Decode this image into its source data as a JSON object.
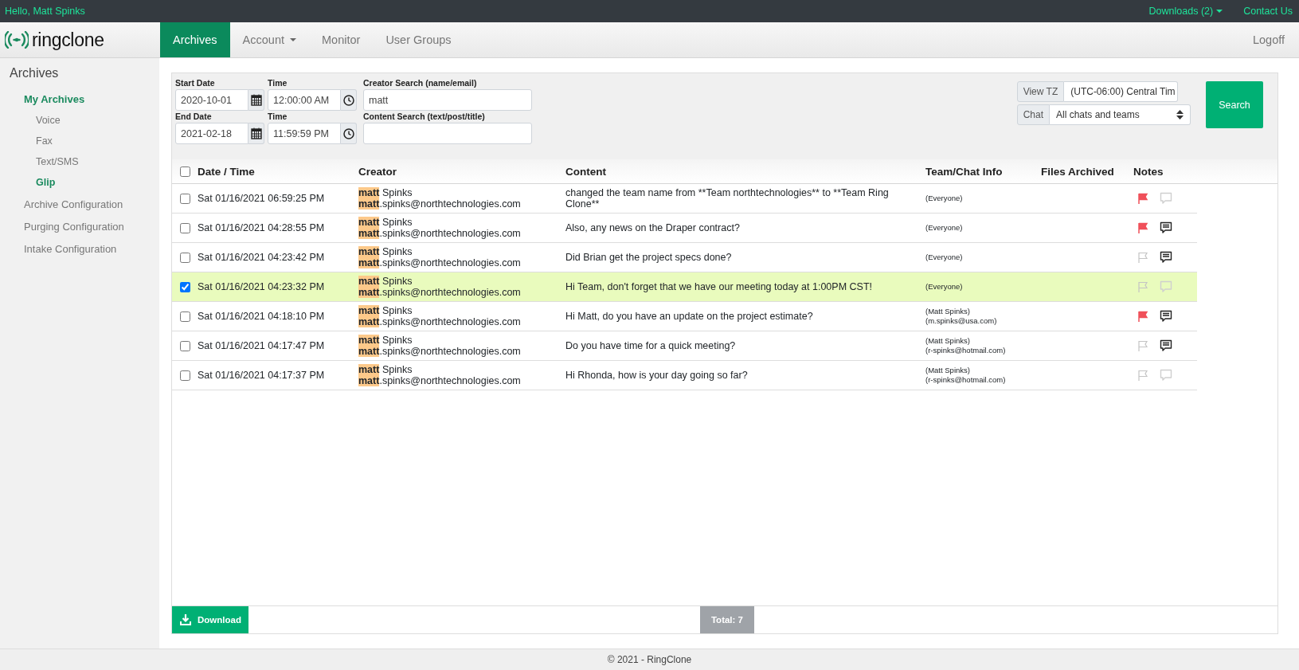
{
  "top_bar": {
    "greeting": "Hello, Matt Spinks",
    "links": [
      {
        "label": "Downloads (2)",
        "dropdown": true
      },
      {
        "label": "Contact Us",
        "dropdown": false
      }
    ]
  },
  "nav": {
    "logo": "ringclone",
    "tabs": [
      {
        "label": "Archives",
        "selected": true,
        "dropdown": false
      },
      {
        "label": "Account",
        "selected": false,
        "dropdown": true
      },
      {
        "label": "Monitor",
        "selected": false,
        "dropdown": false
      },
      {
        "label": "User Groups",
        "selected": false,
        "dropdown": false
      }
    ],
    "logoff": "Logoff"
  },
  "sidebar": {
    "title": "Archives",
    "items": [
      {
        "label": "My Archives",
        "selected": true,
        "children": [
          {
            "label": "Voice",
            "selected": false
          },
          {
            "label": "Fax",
            "selected": false
          },
          {
            "label": "Text/SMS",
            "selected": false
          },
          {
            "label": "Glip",
            "selected": true
          }
        ]
      },
      {
        "label": "Archive Configuration",
        "selected": false
      },
      {
        "label": "Purging Configuration",
        "selected": false
      },
      {
        "label": "Intake Configuration",
        "selected": false
      }
    ]
  },
  "filters": {
    "start_date": {
      "label": "Start Date",
      "value": "2020-10-01"
    },
    "start_time": {
      "label": "Time",
      "value": "12:00:00 AM"
    },
    "creator_search": {
      "label": "Creator Search (name/email)",
      "value": "matt"
    },
    "end_date": {
      "label": "End Date",
      "value": "2021-02-18"
    },
    "end_time": {
      "label": "Time",
      "value": "11:59:59 PM"
    },
    "content_search": {
      "label": "Content Search (text/post/title)"
    },
    "view_tz": {
      "label": "View TZ",
      "value": "(UTC-06:00) Central Tim"
    },
    "chat": {
      "label": "Chat",
      "value": "All chats and teams"
    },
    "search_button": "Search"
  },
  "table": {
    "select_all": false,
    "columns": [
      "Date / Time",
      "Creator",
      "Content",
      "Team/Chat Info",
      "Files Archived",
      "Notes"
    ],
    "rows": [
      {
        "selected": false,
        "date": "Sat 01/16/2021 06:59:25 PM",
        "name_match": "matt",
        "email_match": "matt",
        "name_rest": " Spinks",
        "email_rest": ".spinks@northtechnologies.com",
        "content": "changed the team name from **Team northtechnologies** to **Team Ring Clone**",
        "team": [
          "(Everyone)"
        ],
        "flagged": true,
        "has_note": false
      },
      {
        "selected": false,
        "date": "Sat 01/16/2021 04:28:55 PM",
        "name_match": "matt",
        "email_match": "matt",
        "name_rest": " Spinks",
        "email_rest": ".spinks@northtechnologies.com",
        "content": "Also, any news on the Draper contract?",
        "team": [
          "(Everyone)"
        ],
        "flagged": true,
        "has_note": true
      },
      {
        "selected": false,
        "date": "Sat 01/16/2021 04:23:42 PM",
        "name_match": "matt",
        "email_match": "matt",
        "name_rest": " Spinks",
        "email_rest": ".spinks@northtechnologies.com",
        "content": "Did Brian get the project specs done?",
        "team": [
          "(Everyone)"
        ],
        "flagged": false,
        "has_note": true
      },
      {
        "selected": true,
        "date": "Sat 01/16/2021 04:23:32 PM",
        "name_match": "matt",
        "email_match": "matt",
        "name_rest": " Spinks",
        "email_rest": ".spinks@northtechnologies.com",
        "content": "Hi Team, don't forget that we have our meeting today at 1:00PM CST!",
        "team": [
          "(Everyone)"
        ],
        "flagged": false,
        "has_note": false
      },
      {
        "selected": false,
        "date": "Sat 01/16/2021 04:18:10 PM",
        "name_match": "matt",
        "email_match": "matt",
        "name_rest": " Spinks",
        "email_rest": ".spinks@northtechnologies.com",
        "content": "Hi Matt, do you have an update on the project estimate?",
        "team": [
          "(Matt Spinks)",
          "(m.spinks@usa.com)"
        ],
        "flagged": true,
        "has_note": true
      },
      {
        "selected": false,
        "date": "Sat 01/16/2021 04:17:47 PM",
        "name_match": "matt",
        "email_match": "matt",
        "name_rest": " Spinks",
        "email_rest": ".spinks@northtechnologies.com",
        "content": "Do you have time for a quick meeting?",
        "team": [
          "(Matt Spinks)",
          "(r-spinks@hotmail.com)"
        ],
        "flagged": false,
        "has_note": true
      },
      {
        "selected": false,
        "date": "Sat 01/16/2021 04:17:37 PM",
        "name_match": "matt",
        "email_match": "matt",
        "name_rest": " Spinks",
        "email_rest": ".spinks@northtechnologies.com",
        "content": "Hi Rhonda, how is your day going so far?",
        "team": [
          "(Matt Spinks)",
          "(r-spinks@hotmail.com)"
        ],
        "flagged": false,
        "has_note": false
      }
    ]
  },
  "footer_bar": {
    "download": "Download",
    "total": "Total: 7"
  },
  "footer": "© 2021 - RingClone"
}
